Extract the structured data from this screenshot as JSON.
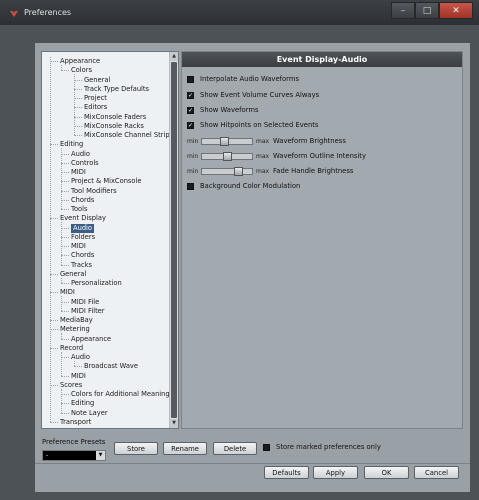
{
  "window": {
    "title": "Preferences",
    "buttons": {
      "minimize": "–",
      "maximize": "□",
      "close": "✕"
    }
  },
  "tree": {
    "items": [
      {
        "label": "Appearance",
        "level": 0
      },
      {
        "label": "Colors",
        "level": 1
      },
      {
        "label": "General",
        "level": 2
      },
      {
        "label": "Track Type Defaults",
        "level": 2
      },
      {
        "label": "Project",
        "level": 2
      },
      {
        "label": "Editors",
        "level": 2
      },
      {
        "label": "MixConsole Faders",
        "level": 2
      },
      {
        "label": "MixConsole Racks",
        "level": 2
      },
      {
        "label": "MixConsole Channel Strip",
        "level": 2
      },
      {
        "label": "Editing",
        "level": 0
      },
      {
        "label": "Audio",
        "level": 1
      },
      {
        "label": "Controls",
        "level": 1
      },
      {
        "label": "MIDI",
        "level": 1
      },
      {
        "label": "Project & MixConsole",
        "level": 1
      },
      {
        "label": "Tool Modifiers",
        "level": 1
      },
      {
        "label": "Chords",
        "level": 1
      },
      {
        "label": "Tools",
        "level": 1
      },
      {
        "label": "Event Display",
        "level": 0
      },
      {
        "label": "Audio",
        "level": 1,
        "selected": true
      },
      {
        "label": "Folders",
        "level": 1
      },
      {
        "label": "MIDI",
        "level": 1
      },
      {
        "label": "Chords",
        "level": 1
      },
      {
        "label": "Tracks",
        "level": 1
      },
      {
        "label": "General",
        "level": 0
      },
      {
        "label": "Personalization",
        "level": 1
      },
      {
        "label": "MIDI",
        "level": 0
      },
      {
        "label": "MIDI File",
        "level": 1
      },
      {
        "label": "MIDI Filter",
        "level": 1
      },
      {
        "label": "MediaBay",
        "level": 0
      },
      {
        "label": "Metering",
        "level": 0
      },
      {
        "label": "Appearance",
        "level": 1
      },
      {
        "label": "Record",
        "level": 0
      },
      {
        "label": "Audio",
        "level": 1
      },
      {
        "label": "Broadcast Wave",
        "level": 2
      },
      {
        "label": "MIDI",
        "level": 1
      },
      {
        "label": "Scores",
        "level": 0
      },
      {
        "label": "Colors for Additional Meanings",
        "level": 1
      },
      {
        "label": "Editing",
        "level": 1
      },
      {
        "label": "Note Layer",
        "level": 1
      },
      {
        "label": "Transport",
        "level": 0
      }
    ]
  },
  "panel": {
    "title": "Event Display-Audio",
    "options": [
      {
        "label": "Interpolate Audio Waveforms",
        "checked": false
      },
      {
        "label": "Show Event Volume Curves Always",
        "checked": true
      },
      {
        "label": "Show Waveforms",
        "checked": true
      },
      {
        "label": "Show Hitpoints on Selected Events",
        "checked": true
      }
    ],
    "sliders": [
      {
        "min": "min",
        "max": "max",
        "label": "Waveform Brightness",
        "value": 0.45
      },
      {
        "min": "min",
        "max": "max",
        "label": "Waveform Outline Intensity",
        "value": 0.5
      },
      {
        "min": "min",
        "max": "max",
        "label": "Fade Handle Brightness",
        "value": 0.78
      }
    ],
    "bg_option": {
      "label": "Background Color Modulation",
      "checked": false
    }
  },
  "presets": {
    "label": "Preference Presets",
    "selected": "-",
    "store": "Store",
    "rename": "Rename",
    "delete": "Delete",
    "store_marked": "Store marked preferences only"
  },
  "footer": {
    "defaults": "Defaults",
    "apply": "Apply",
    "ok": "OK",
    "cancel": "Cancel"
  }
}
